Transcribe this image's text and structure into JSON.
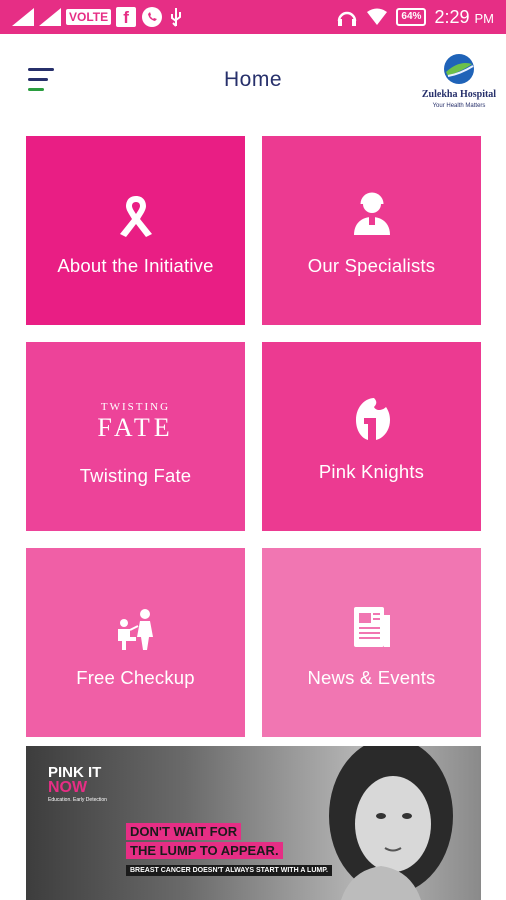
{
  "status_bar": {
    "volte_label": "VOLTE",
    "facebook_glyph": "f",
    "battery": "64%",
    "time": "2:29",
    "ampm": "PM",
    "background": "#e62e85"
  },
  "header": {
    "title": "Home",
    "logo": {
      "name": "Zulekha Hospital",
      "tagline": "Your Health Matters"
    }
  },
  "tiles": [
    {
      "label": "About the Initiative",
      "icon": "ribbon-icon",
      "color": "#e91e84"
    },
    {
      "label": "Our Specialists",
      "icon": "specialist-icon",
      "color": "#ec3a91"
    },
    {
      "label": "Twisting Fate",
      "icon": "twisting-fate-logo",
      "logo_top": "TWISTING",
      "logo_bottom": "FATE",
      "color": "#ed4399"
    },
    {
      "label": "Pink Knights",
      "icon": "knight-helmet-icon",
      "color": "#ec3a91"
    },
    {
      "label": "Free Checkup",
      "icon": "checkup-icon",
      "color": "#f05fa6"
    },
    {
      "label": "News & Events",
      "icon": "newspaper-icon",
      "color": "#f176b2"
    }
  ],
  "banner": {
    "brand_line1": "PINK IT",
    "brand_line2": "NOW",
    "brand_sub": "Education. Early Detection",
    "headline1": "DON'T WAIT FOR",
    "headline2": "THE LUMP TO APPEAR.",
    "subline": "BREAST CANCER DOESN'T ALWAYS START WITH A LUMP.",
    "accent": "#e62e85"
  }
}
